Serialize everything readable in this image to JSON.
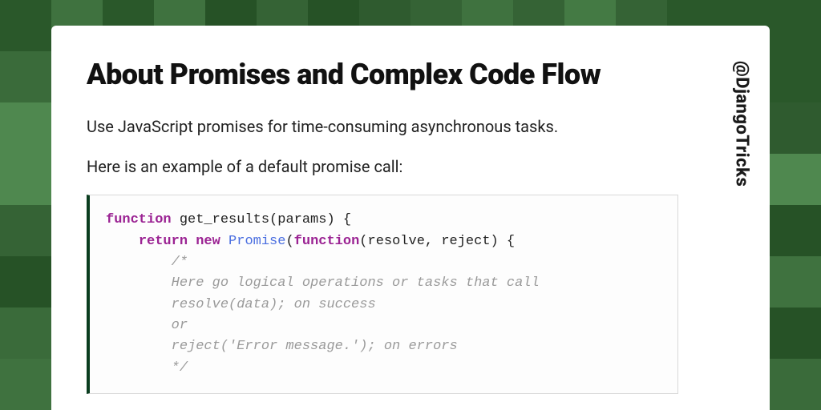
{
  "handle": "@DjangoTricks",
  "title": "About Promises and Complex Code Flow",
  "intro": "Use JavaScript promises for time-consuming asynchronous tasks.",
  "lead_in": "Here is an example of a default promise call:",
  "bg_palette": [
    "#2f5b2f",
    "#3a6b3a",
    "#447a44",
    "#4f884f",
    "#265226",
    "#356335",
    "#3f723f",
    "#2a582a"
  ],
  "code": {
    "l1_kw": "function",
    "l1_rest": " get_results(params) {",
    "l2_indent": "    ",
    "l2_kw1": "return",
    "l2_sp1": " ",
    "l2_kw2": "new",
    "l2_sp2": " ",
    "l2_cls": "Promise",
    "l2_paren": "(",
    "l2_kw3": "function",
    "l2_rest": "(resolve, reject) {",
    "l3": "        /*",
    "l4": "        Here go logical operations or tasks that call",
    "l5": "        resolve(data); on success",
    "l6": "        or",
    "l7": "        reject('Error message.'); on errors",
    "l8": "        */"
  }
}
